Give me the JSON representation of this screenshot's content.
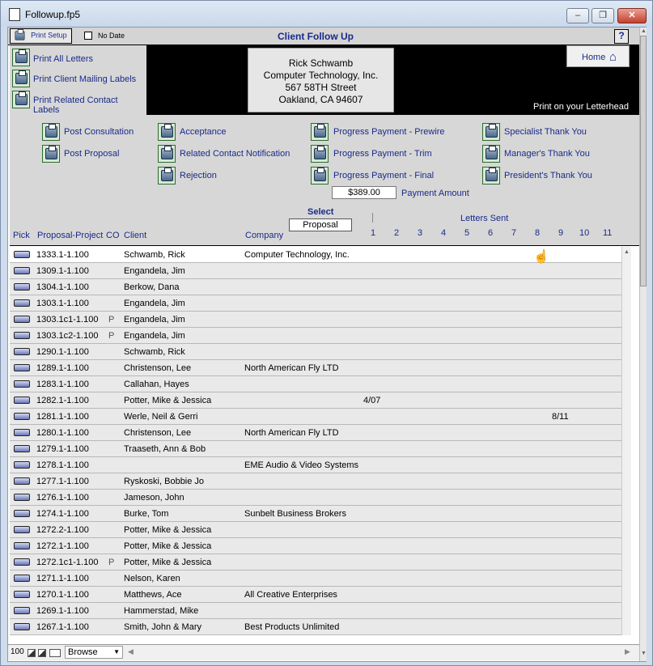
{
  "window": {
    "title": "Followup.fp5",
    "minimize": "–",
    "restore": "❐",
    "close": "✕"
  },
  "header": {
    "print_setup": "Print Setup",
    "no_date": "No Date",
    "title": "Client Follow Up",
    "help": "?"
  },
  "left_actions": [
    "Print All Letters",
    "Print Client Mailing Labels",
    "Print Related Contact Labels"
  ],
  "address": {
    "name": "Rick Schwamb",
    "company": "Computer Technology, Inc.",
    "street": "567 58TH Street",
    "city": "Oakland, CA 94607"
  },
  "home_label": "Home",
  "letterhead_note": "Print on your Letterhead",
  "letters": [
    [
      "Post Consultation",
      "Post Proposal"
    ],
    [
      "Acceptance",
      "Related Contact Notification",
      "Rejection"
    ],
    [
      "Progress Payment - Prewire",
      "Progress Payment - Trim",
      "Progress Payment - Final"
    ],
    [
      "Specialist Thank You",
      "Manager's Thank You",
      "President's Thank You"
    ]
  ],
  "payment": {
    "value": "$389.00",
    "label": "Payment Amount"
  },
  "select": {
    "label": "Select",
    "value": "Proposal"
  },
  "letters_sent_label": "Letters Sent",
  "columns": {
    "pick": "Pick",
    "proposal": "Proposal-Project",
    "co": "CO",
    "client": "Client",
    "company": "Company",
    "nums": [
      "1",
      "2",
      "3",
      "4",
      "5",
      "6",
      "7",
      "8",
      "9",
      "10",
      "11"
    ]
  },
  "rows": [
    {
      "proposal": "1333.1-1.100",
      "co": "",
      "client": "Schwamb, Rick",
      "company": "Computer Technology, Inc.",
      "sent": ""
    },
    {
      "proposal": "1309.1-1.100",
      "co": "",
      "client": "Engandela, Jim",
      "company": "",
      "sent": ""
    },
    {
      "proposal": "1304.1-1.100",
      "co": "",
      "client": "Berkow, Dana",
      "company": "",
      "sent": ""
    },
    {
      "proposal": "1303.1-1.100",
      "co": "",
      "client": "Engandela, Jim",
      "company": "",
      "sent": ""
    },
    {
      "proposal": "1303.1c1-1.100",
      "co": "P",
      "client": "Engandela, Jim",
      "company": "",
      "sent": ""
    },
    {
      "proposal": "1303.1c2-1.100",
      "co": "P",
      "client": "Engandela, Jim",
      "company": "",
      "sent": ""
    },
    {
      "proposal": "1290.1-1.100",
      "co": "",
      "client": "Schwamb, Rick",
      "company": "",
      "sent": ""
    },
    {
      "proposal": "1289.1-1.100",
      "co": "",
      "client": "Christenson, Lee",
      "company": "North American Fly LTD",
      "sent": ""
    },
    {
      "proposal": "1283.1-1.100",
      "co": "",
      "client": "Callahan, Hayes",
      "company": "",
      "sent": ""
    },
    {
      "proposal": "1282.1-1.100",
      "co": "",
      "client": "Potter, Mike & Jessica",
      "company": "",
      "sent": "4/07"
    },
    {
      "proposal": "1281.1-1.100",
      "co": "",
      "client": "Werle, Neil & Gerri",
      "company": "",
      "sent": "8/11"
    },
    {
      "proposal": "1280.1-1.100",
      "co": "",
      "client": "Christenson, Lee",
      "company": "North American Fly LTD",
      "sent": ""
    },
    {
      "proposal": "1279.1-1.100",
      "co": "",
      "client": "Traaseth, Ann & Bob",
      "company": "",
      "sent": ""
    },
    {
      "proposal": "1278.1-1.100",
      "co": "",
      "client": "",
      "company": "EME Audio & Video Systems",
      "sent": ""
    },
    {
      "proposal": "1277.1-1.100",
      "co": "",
      "client": "Ryskoski, Bobbie Jo",
      "company": "",
      "sent": ""
    },
    {
      "proposal": "1276.1-1.100",
      "co": "",
      "client": "Jameson, John",
      "company": "",
      "sent": ""
    },
    {
      "proposal": "1274.1-1.100",
      "co": "",
      "client": "Burke, Tom",
      "company": "Sunbelt Business Brokers",
      "sent": ""
    },
    {
      "proposal": "1272.2-1.100",
      "co": "",
      "client": "Potter, Mike & Jessica",
      "company": "",
      "sent": ""
    },
    {
      "proposal": "1272.1-1.100",
      "co": "",
      "client": "Potter, Mike & Jessica",
      "company": "",
      "sent": ""
    },
    {
      "proposal": "1272.1c1-1.100",
      "co": "P",
      "client": "Potter, Mike & Jessica",
      "company": "",
      "sent": ""
    },
    {
      "proposal": "1271.1-1.100",
      "co": "",
      "client": "Nelson, Karen",
      "company": "",
      "sent": ""
    },
    {
      "proposal": "1270.1-1.100",
      "co": "",
      "client": "Matthews, Ace",
      "company": "All Creative Enterprises",
      "sent": ""
    },
    {
      "proposal": "1269.1-1.100",
      "co": "",
      "client": "Hammerstad, Mike",
      "company": "",
      "sent": ""
    },
    {
      "proposal": "1267.1-1.100",
      "co": "",
      "client": "Smith, John & Mary",
      "company": "Best Products Unlimited",
      "sent": ""
    }
  ],
  "status": {
    "zoom": "100",
    "mode": "Browse"
  }
}
